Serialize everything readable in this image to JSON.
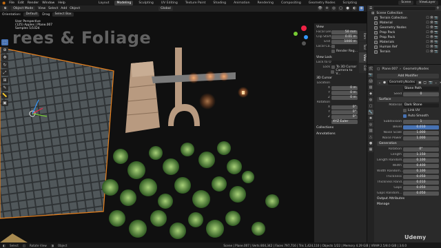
{
  "topbar": {
    "menus": [
      "File",
      "Edit",
      "Render",
      "Window",
      "Help"
    ],
    "workspaces": [
      "Layout",
      "Modeling",
      "Sculpting",
      "UV Editing",
      "Texture Paint",
      "Shading",
      "Animation",
      "Rendering",
      "Compositing",
      "Geometry Nodes",
      "Scripting"
    ],
    "active_workspace": "Modeling",
    "scene_name": "Scene",
    "view_layer": "ViewLayer"
  },
  "viewport_header": {
    "mode": "Object Mode",
    "menus": [
      "View",
      "Select",
      "Add",
      "Object"
    ],
    "orientation": "Global",
    "drag_label": "Drag",
    "select_box": "Select Box",
    "transform_orientation": "Default"
  },
  "viewport": {
    "overlay_lines": [
      "User Perspective",
      "(125) Apples | Plane.007",
      "Samples 5/1024"
    ],
    "watermark": "rees & Foliage"
  },
  "npanel": {
    "view": {
      "title": "View",
      "focal_length_label": "Focal Len...",
      "focal_length": "50 mm",
      "clip_start_label": "Clip Start",
      "clip_start": "0.01 m",
      "clip_end_label": "End",
      "clip_end": "1000 m",
      "local_camera_label": "Local Ca...",
      "render_region_label": "Render Reg..."
    },
    "view_lock": {
      "title": "View Lock",
      "lock_to_object_label": "Lock to Ob...",
      "lock_label": "Lock",
      "to_3d_cursor": "To 3D Cursor",
      "camera_to_view": "Camera to V..."
    },
    "cursor": {
      "title": "3D Cursor",
      "location_label": "Location",
      "loc": [
        "0 m",
        "0 m",
        "0 m"
      ],
      "rotation_label": "Rotation",
      "rot": [
        "0°",
        "0°",
        "0°"
      ],
      "rotation_mode": "XYZ Euler",
      "axis": [
        "X",
        "Y",
        "Z"
      ]
    },
    "collections": "Collections",
    "annotations": "Annotations",
    "tabs": [
      "Item",
      "Tool",
      "View",
      "Edit"
    ]
  },
  "outliner": {
    "root": "Scene Collection",
    "items": [
      {
        "name": "Terrain Collection"
      },
      {
        "name": "Material"
      },
      {
        "name": "Geometry Nodes"
      },
      {
        "name": "Prop Pack"
      },
      {
        "name": "Prop Pack"
      },
      {
        "name": "Materials"
      },
      {
        "name": "Human Ref"
      },
      {
        "name": "Terrain"
      }
    ]
  },
  "properties": {
    "object_crumb": "Plane.007",
    "modifier_crumb": "GeometryNodes",
    "add_modifier": "Add Modifier",
    "modifier_name": "GeometryNodes",
    "stone_path_label": "Stone Path",
    "seed_label": "Seed",
    "seed": "0",
    "surface_label": "Surface",
    "material_label": "Material",
    "material_value": "Dark Stone",
    "link_uv": "Link UV",
    "auto_smooth": "Auto Smooth",
    "subdivision_label": "Subdivision",
    "subdivision": "1",
    "bevel_label": "Bevel",
    "bevel": "0.010",
    "noise_scale_label": "Noise Scale",
    "noise_scale": "1.000",
    "noise_power_label": "Noise Power",
    "noise_power": "1.000",
    "generation_label": "Generation",
    "rotation_label": "Rotation",
    "rotation": "0°",
    "length_label": "Length",
    "length": "1.150",
    "length_random_label": "Length Random...",
    "length_random": "0.100",
    "width_label": "Width",
    "width": "0.400",
    "width_random_label": "Width Random...",
    "width_random": "0.100",
    "thickness_label": "Thickness",
    "thickness": "0.050",
    "thickness_rand_label": "Thickness Rand...",
    "thickness_rand": "0.010",
    "gaps_label": "Gaps",
    "gaps": "0.050",
    "gaps_random_label": "Gaps Random...",
    "gaps_random": "0.050",
    "output_attributes": "Output Attributes",
    "manage": "Manage"
  },
  "statusbar": {
    "left": [
      "Select",
      "Rotate View",
      "Object"
    ],
    "stats": "Scene | Plane.007 | Verts 804,342 | Faces 797,716 | Tris 1,424,110 | Objects 1/22 | Memory 4.29 GiB | VRAM 2.5/8.0 GiB | 3.6.0"
  },
  "brand": "Udemy"
}
